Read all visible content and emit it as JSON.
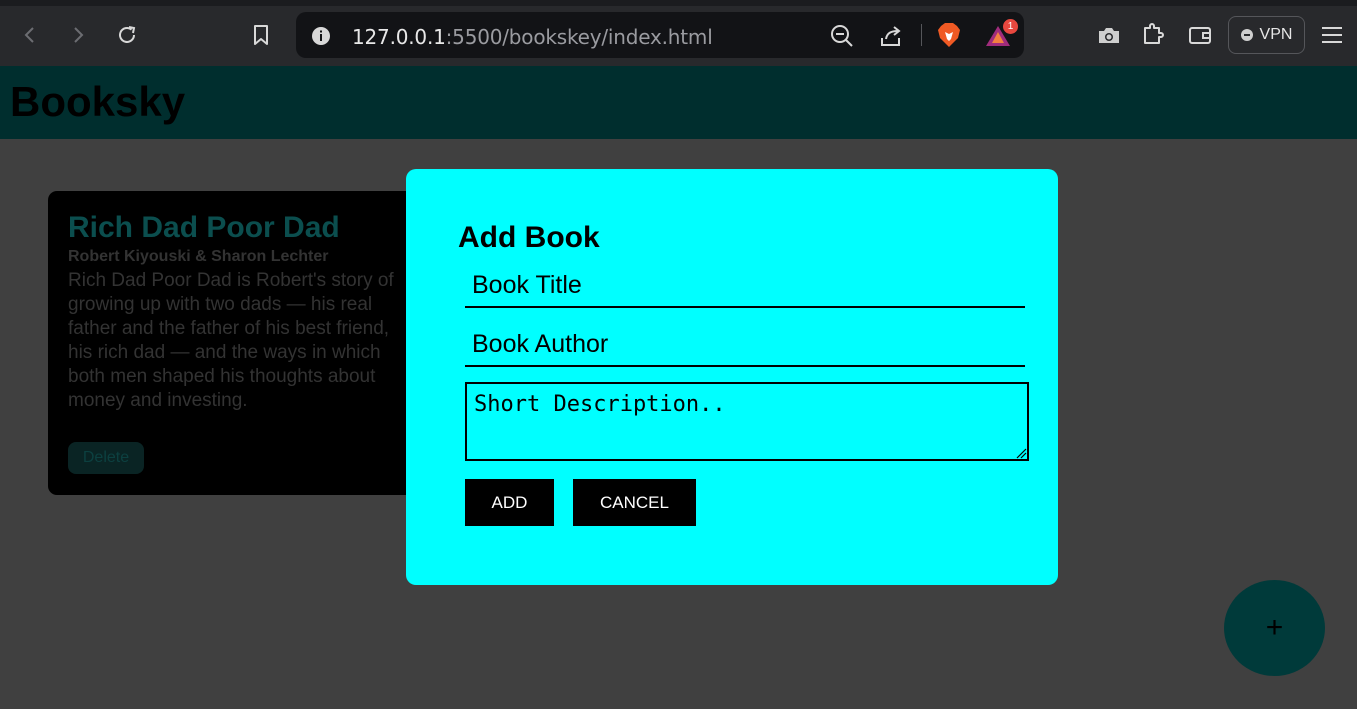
{
  "browser": {
    "url_host": "127.0.0.1",
    "url_rest": ":5500/bookskey/index.html",
    "vpn_label": "VPN",
    "notification_count": "1"
  },
  "app": {
    "title": "Booksky"
  },
  "book": {
    "title": "Rich Dad Poor Dad",
    "author": "Robert Kiyouski & Sharon Lechter",
    "description": "Rich Dad Poor Dad is Robert's story of growing up with two dads — his real father and the father of his best friend, his rich dad — and the ways in which both men shaped his thoughts about money and investing.",
    "delete_label": "Delete"
  },
  "modal": {
    "heading": "Add Book",
    "title_placeholder": "Book Title",
    "author_placeholder": "Book Author",
    "description_placeholder": "Short Description..",
    "add_label": "ADD",
    "cancel_label": "CANCEL"
  },
  "fab": {
    "label": "+"
  },
  "colors": {
    "header": "#002e2e",
    "modal": "#00ffff",
    "overlay": "#404040",
    "card": "#000000"
  }
}
